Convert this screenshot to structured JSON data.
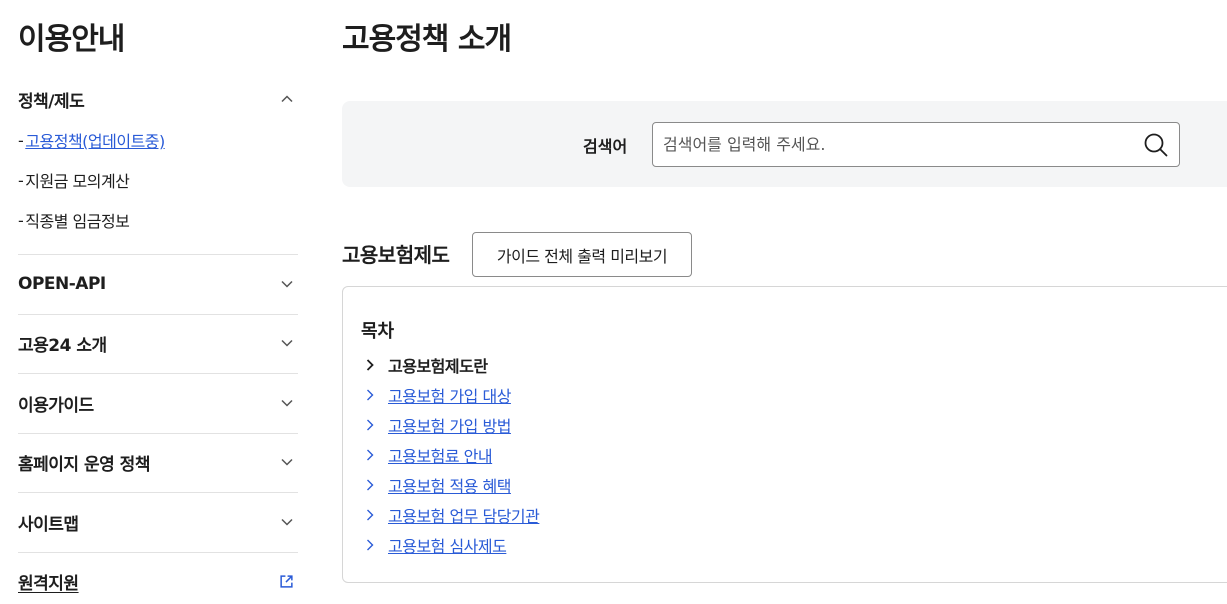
{
  "sidebar": {
    "title": "이용안내",
    "sections": [
      {
        "label": "정책/제도",
        "expanded": true
      },
      {
        "label": "OPEN-API",
        "expanded": false
      },
      {
        "label": "고용24 소개",
        "expanded": false
      },
      {
        "label": "이용가이드",
        "expanded": false
      },
      {
        "label": "홈페이지 운영 정책",
        "expanded": false
      },
      {
        "label": "사이트맵",
        "expanded": false
      },
      {
        "label": "원격지원",
        "external": true
      }
    ],
    "sub_items": [
      {
        "dash": "-",
        "label": "고용정책(업데이트중)",
        "active": true
      },
      {
        "dash": "-",
        "label": "지원금 모의계산",
        "active": false
      },
      {
        "dash": "-",
        "label": "직종별 임금정보",
        "active": false
      }
    ]
  },
  "main": {
    "page_title": "고용정책 소개",
    "search": {
      "label": "검색어",
      "placeholder": "검색어를 입력해 주세요.",
      "value": ""
    },
    "section_title": "고용보험제도",
    "guide_button_label": "가이드 전체 출력 미리보기",
    "toc": {
      "heading": "목차",
      "items": [
        {
          "label": "고용보험제도란",
          "current": true
        },
        {
          "label": "고용보험 가입 대상",
          "current": false
        },
        {
          "label": "고용보험 가입 방법",
          "current": false
        },
        {
          "label": "고용보험료 안내",
          "current": false
        },
        {
          "label": "고용보험 적용 혜택",
          "current": false
        },
        {
          "label": "고용보험 업무 담당기관",
          "current": false
        },
        {
          "label": "고용보험 심사제도",
          "current": false
        }
      ]
    }
  },
  "colors": {
    "link": "#2a5bd7",
    "text": "#1e1e1e",
    "search_bg": "#f4f5f6",
    "border": "#8a8a8a",
    "divider": "#e2e2e2"
  },
  "icons": {
    "section_collapse": "chevron-up-icon",
    "section_expand": "chevron-down-icon",
    "external": "external-link-icon",
    "search": "search-icon",
    "toc_arrow": "chevron-right-icon"
  }
}
